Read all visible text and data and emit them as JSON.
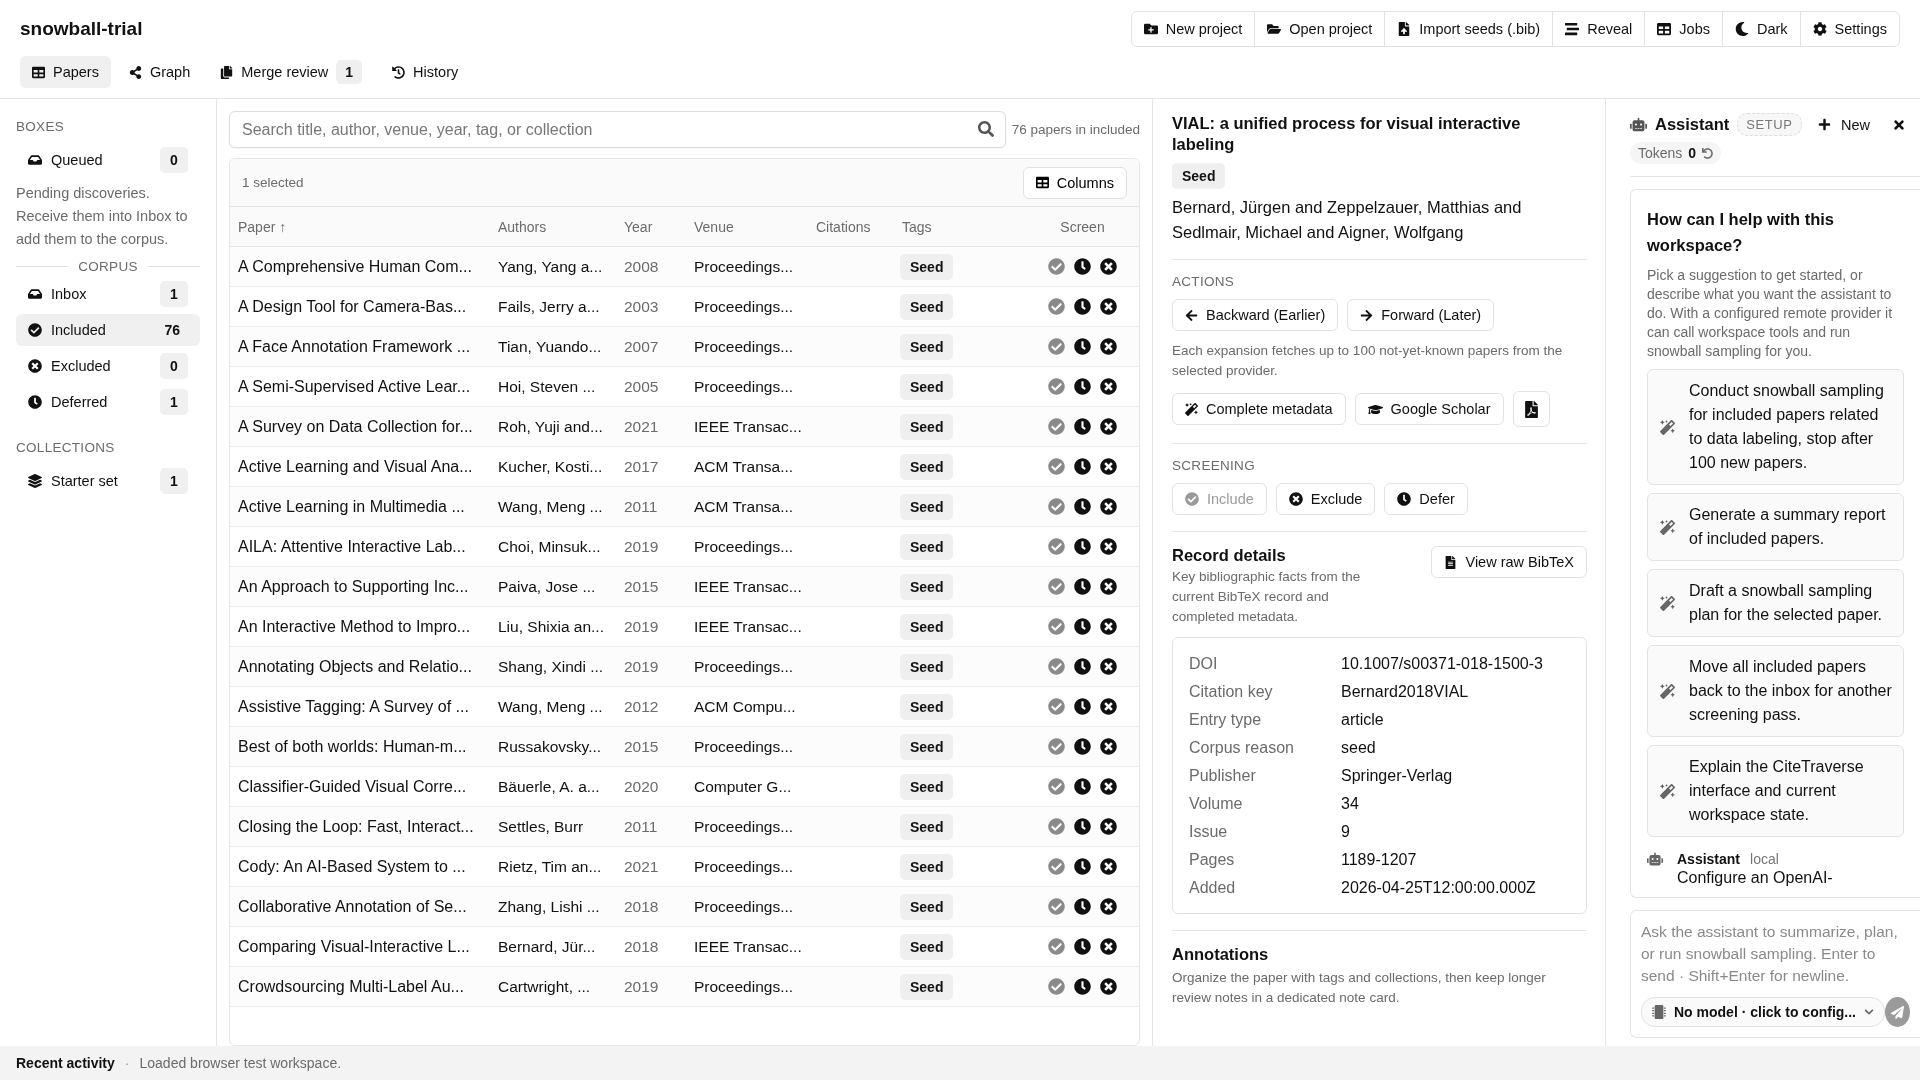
{
  "app": {
    "title": "snowball-trial"
  },
  "toolbar": [
    "New project",
    "Open project",
    "Import seeds (.bib)",
    "Reveal",
    "Jobs",
    "Dark",
    "Settings"
  ],
  "tabs": [
    {
      "label": "Papers",
      "selected": true
    },
    {
      "label": "Graph",
      "selected": false
    },
    {
      "label": "Merge review",
      "selected": false,
      "badge": "1"
    },
    {
      "label": "History",
      "selected": false
    }
  ],
  "sidebar": {
    "boxes_heading": "BOXES",
    "boxes": [
      {
        "label": "Queued",
        "count": "0",
        "selected": false
      }
    ],
    "boxes_note": "Pending discoveries. Receive them into Inbox to add them to the corpus.",
    "corpus_heading": "CORPUS",
    "corpus": [
      {
        "kind": "inbox",
        "label": "Inbox",
        "count": "1",
        "selected": false
      },
      {
        "kind": "included",
        "label": "Included",
        "count": "76",
        "selected": true
      },
      {
        "kind": "excluded",
        "label": "Excluded",
        "count": "0",
        "selected": false
      },
      {
        "kind": "deferred",
        "label": "Deferred",
        "count": "1",
        "selected": false
      }
    ],
    "collections_heading": "COLLECTIONS",
    "collections": [
      {
        "label": "Starter set",
        "count": "1",
        "selected": false
      }
    ]
  },
  "search": {
    "placeholder": "Search title, author, venue, year, tag, or collection",
    "summary": "76 papers in included"
  },
  "table": {
    "selection": "1 selected",
    "columns_button": "Columns",
    "columns": [
      "Paper ↑",
      "Authors",
      "Year",
      "Venue",
      "Citations",
      "Tags",
      "Screen"
    ],
    "rows": [
      {
        "paper": "A Comprehensive Human Com...",
        "authors": "Yang, Yang a...",
        "year": "2008",
        "venue": "Proceedings...",
        "tag": "Seed",
        "included": true
      },
      {
        "paper": "A Design Tool for Camera-Bas...",
        "authors": "Fails, Jerry a...",
        "year": "2003",
        "venue": "Proceedings...",
        "tag": "Seed",
        "included": true
      },
      {
        "paper": "A Face Annotation Framework ...",
        "authors": "Tian, Yuando...",
        "year": "2007",
        "venue": "Proceedings...",
        "tag": "Seed",
        "included": true
      },
      {
        "paper": "A Semi-Supervised Active Lear...",
        "authors": "Hoi, Steven ...",
        "year": "2005",
        "venue": "Proceedings...",
        "tag": "Seed",
        "included": true
      },
      {
        "paper": "A Survey on Data Collection for...",
        "authors": "Roh, Yuji and...",
        "year": "2021",
        "venue": "IEEE Transac...",
        "tag": "Seed",
        "included": true
      },
      {
        "paper": "Active Learning and Visual Ana...",
        "authors": "Kucher, Kosti...",
        "year": "2017",
        "venue": "ACM Transa...",
        "tag": "Seed",
        "included": true
      },
      {
        "paper": "Active Learning in Multimedia ...",
        "authors": "Wang, Meng ...",
        "year": "2011",
        "venue": "ACM Transa...",
        "tag": "Seed",
        "included": true
      },
      {
        "paper": "AILA: Attentive Interactive Lab...",
        "authors": "Choi, Minsuk...",
        "year": "2019",
        "venue": "Proceedings...",
        "tag": "Seed",
        "included": true
      },
      {
        "paper": "An Approach to Supporting Inc...",
        "authors": "Paiva, Jose ...",
        "year": "2015",
        "venue": "IEEE Transac...",
        "tag": "Seed",
        "included": true
      },
      {
        "paper": "An Interactive Method to Impro...",
        "authors": "Liu, Shixia an...",
        "year": "2019",
        "venue": "IEEE Transac...",
        "tag": "Seed",
        "included": true
      },
      {
        "paper": "Annotating Objects and Relatio...",
        "authors": "Shang, Xindi ...",
        "year": "2019",
        "venue": "Proceedings...",
        "tag": "Seed",
        "included": true
      },
      {
        "paper": "Assistive Tagging: A Survey of ...",
        "authors": "Wang, Meng ...",
        "year": "2012",
        "venue": "ACM Compu...",
        "tag": "Seed",
        "included": true
      },
      {
        "paper": "Best of both worlds: Human-m...",
        "authors": "Russakovsky...",
        "year": "2015",
        "venue": "Proceedings...",
        "tag": "Seed",
        "included": true
      },
      {
        "paper": "Classifier-Guided Visual Corre...",
        "authors": "Bäuerle, A. a...",
        "year": "2020",
        "venue": "Computer G...",
        "tag": "Seed",
        "included": true
      },
      {
        "paper": "Closing the Loop: Fast, Interact...",
        "authors": "Settles, Burr",
        "year": "2011",
        "venue": "Proceedings...",
        "tag": "Seed",
        "included": true
      },
      {
        "paper": "Cody: An AI-Based System to ...",
        "authors": "Rietz, Tim an...",
        "year": "2021",
        "venue": "Proceedings...",
        "tag": "Seed",
        "included": true
      },
      {
        "paper": "Collaborative Annotation of Se...",
        "authors": "Zhang, Lishi ...",
        "year": "2018",
        "venue": "Proceedings...",
        "tag": "Seed",
        "included": true
      },
      {
        "paper": "Comparing Visual-Interactive L...",
        "authors": "Bernard, Jür...",
        "year": "2018",
        "venue": "IEEE Transac...",
        "tag": "Seed",
        "included": true
      },
      {
        "paper": "Crowdsourcing Multi-Label Au...",
        "authors": "Cartwright, ...",
        "year": "2019",
        "venue": "Proceedings...",
        "tag": "Seed",
        "included": true
      }
    ]
  },
  "detail": {
    "title": "VIAL: a unified process for visual interactive labeling",
    "tag": "Seed",
    "authors": "Bernard, Jürgen and Zeppelzauer, Matthias and Sedlmair, Michael and Aigner, Wolfgang",
    "actions_heading": "ACTIONS",
    "expand_buttons": [
      "Backward (Earlier)",
      "Forward (Later)"
    ],
    "expand_note": "Each expansion fetches up to 100 not-yet-known papers from the selected provider.",
    "tool_buttons": [
      "Complete metadata",
      "Google Scholar"
    ],
    "screening_heading": "SCREENING",
    "screening_buttons": [
      {
        "kind": "include",
        "label": "Include",
        "disabled": true
      },
      {
        "kind": "exclude",
        "label": "Exclude",
        "disabled": false
      },
      {
        "kind": "defer",
        "label": "Defer",
        "disabled": false
      }
    ],
    "record_title": "Record details",
    "record_note": "Key bibliographic facts from the current BibTeX record and completed metadata.",
    "raw_button": "View raw BibTeX",
    "fields": [
      {
        "label": "DOI",
        "value": "10.1007/s00371-018-1500-3"
      },
      {
        "label": "Citation key",
        "value": "Bernard2018VIAL"
      },
      {
        "label": "Entry type",
        "value": "article"
      },
      {
        "label": "Corpus reason",
        "value": "seed"
      },
      {
        "label": "Publisher",
        "value": "Springer-Verlag"
      },
      {
        "label": "Volume",
        "value": "34"
      },
      {
        "label": "Issue",
        "value": "9"
      },
      {
        "label": "Pages",
        "value": "1189-1207"
      },
      {
        "label": "Added",
        "value": "2026-04-25T12:00:00.000Z"
      }
    ],
    "annotations_title": "Annotations",
    "annotations_note": "Organize the paper with tags and collections, then keep longer review notes in a dedicated note card."
  },
  "assistant": {
    "title": "Assistant",
    "badge": "SETUP",
    "new_button": "New",
    "tokens_label": "Tokens",
    "tokens": "0",
    "heading": "How can I help with this workspace?",
    "intro": "Pick a suggestion to get started, or describe what you want the assistant to do. With a configured remote provider it can call workspace tools and run snowball sampling for you.",
    "suggestions": [
      "Conduct snowball sampling for included papers related to data labeling, stop after 100 new papers.",
      "Generate a summary report of included papers.",
      "Draft a snowball sampling plan for the selected paper.",
      "Move all included papers back to the inbox for another screening pass.",
      "Explain the CiteTraverse interface and current workspace state."
    ],
    "message": {
      "author": "Assistant",
      "source": "local",
      "text": "Configure an OpenAI-"
    },
    "input": {
      "placeholder": "Ask the assistant to summarize, plan, or run snowball sampling. Enter to send · Shift+Enter for newline."
    },
    "model": "No model · click to config..."
  },
  "status_bar": {
    "label": "Recent activity",
    "separator": "·",
    "message": "Loaded browser test workspace."
  }
}
